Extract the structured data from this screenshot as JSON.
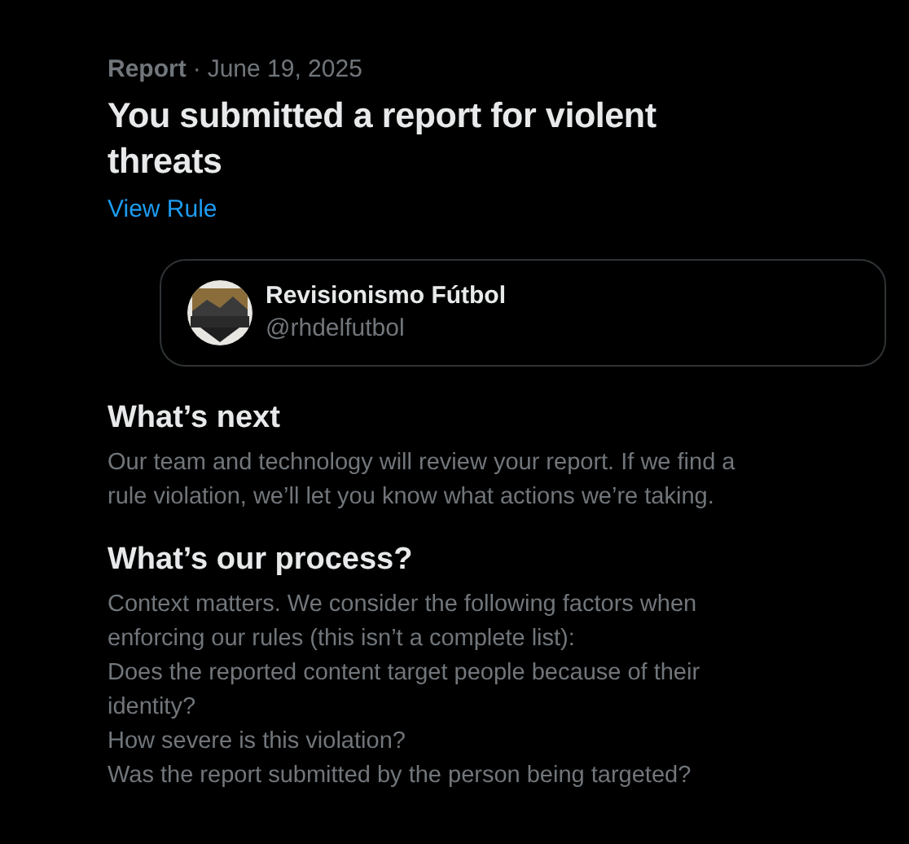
{
  "header": {
    "label": "Report",
    "separator": "·",
    "date": "June 19, 2025"
  },
  "title": "You submitted a report for violent threats",
  "rule_link": "View Rule",
  "account": {
    "name": "Revisionismo Fútbol",
    "handle": "@rhdelfutbol"
  },
  "sections": [
    {
      "heading": "What’s next",
      "lines": [
        "Our team and technology will review your report. If we find a rule violation, we’ll let you know what actions we’re taking."
      ]
    },
    {
      "heading": "What’s our process?",
      "lines": [
        "Context matters. We consider the following factors when enforcing our rules (this isn’t a complete list):",
        "Does the reported content target people because of their identity?",
        "How severe is this violation?",
        "Was the report submitted by the person being targeted?"
      ]
    }
  ]
}
